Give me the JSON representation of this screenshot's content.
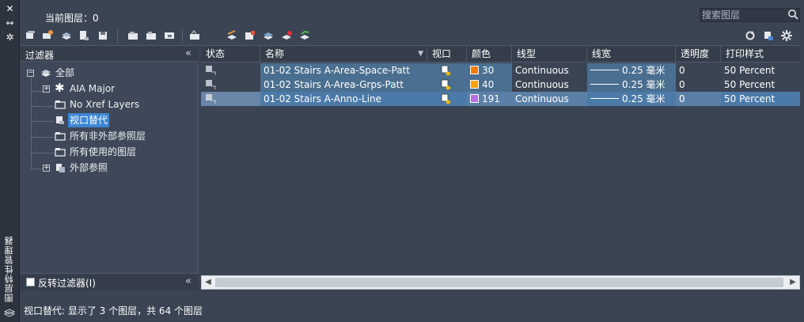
{
  "window": {
    "palette_title": "图层特性管理器",
    "current_layer_label": "当前图层：0"
  },
  "search": {
    "placeholder": "搜索图层"
  },
  "filters": {
    "title": "过滤器",
    "tree": [
      {
        "label": "全部",
        "level": 0,
        "expand": "-",
        "icon": "all-layers-icon"
      },
      {
        "label": "AIA Major",
        "level": 1,
        "expand": "+",
        "icon": "asterisk-filter-icon"
      },
      {
        "label": "No Xref Layers",
        "level": 1,
        "expand": "",
        "icon": "filter-group-icon"
      },
      {
        "label": "视口替代",
        "level": 1,
        "expand": "",
        "icon": "viewport-override-icon",
        "selected": true
      },
      {
        "label": "所有非外部参照层",
        "level": 1,
        "expand": "",
        "icon": "filter-group-icon"
      },
      {
        "label": "所有使用的图层",
        "level": 1,
        "expand": "",
        "icon": "filter-group-icon"
      },
      {
        "label": "外部参照",
        "level": 1,
        "expand": "+",
        "icon": "xref-icon"
      }
    ],
    "invert_label": "反转过滤器(I)"
  },
  "grid": {
    "columns": [
      "状态",
      "名称",
      "视口",
      "颜色",
      "线型",
      "线宽",
      "透明度",
      "打印样式"
    ],
    "rows": [
      {
        "name": "01-02 Stairs A-Area-Space-Patt",
        "color_hex": "#f57c00",
        "color": "30",
        "linetype": "Continuous",
        "lineweight": "0.25 毫米",
        "transparency": "0",
        "plot_style": "50 Percent"
      },
      {
        "name": "01-02 Stairs A-Area-Grps-Patt",
        "color_hex": "#f5a300",
        "color": "40",
        "linetype": "Continuous",
        "lineweight": "0.25 毫米",
        "transparency": "0",
        "plot_style": "50 Percent"
      },
      {
        "name": "01-02 Stairs A-Anno-Line",
        "color_hex": "#b46fe0",
        "color": "191",
        "linetype": "Continuous",
        "lineweight": "0.25 毫米",
        "transparency": "0",
        "plot_style": "50 Percent"
      }
    ]
  },
  "status": {
    "text": "视口替代: 显示了 3 个图层，共 64 个图层"
  }
}
